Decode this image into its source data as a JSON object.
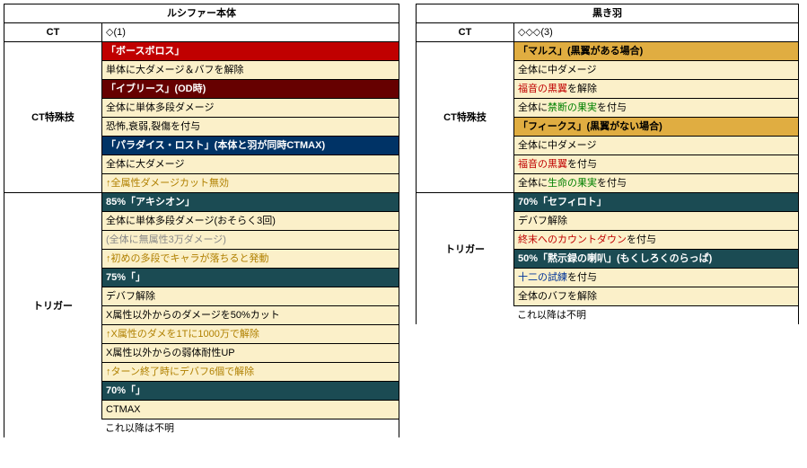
{
  "left": {
    "title": "ルシファー本体",
    "ct_label": "CT",
    "ct_value": "◇(1)",
    "sections": {
      "ct_skill": {
        "label": "CT特殊技",
        "rows": [
          {
            "cls": "hdr hdr-dred",
            "text": "「ボースボロス」"
          },
          {
            "cls": "line-cream",
            "text": "単体に大ダメージ＆バフを解除"
          },
          {
            "cls": "hdr hdr-crim",
            "text": "「イブリース」(OD時)"
          },
          {
            "cls": "line-cream",
            "text": "全体に単体多段ダメージ"
          },
          {
            "cls": "line-cream",
            "text": "恐怖,衰弱,裂傷を付与"
          },
          {
            "cls": "hdr hdr-blue",
            "text": "「パラダイス・ロスト」(本体と羽が同時CTMAX)"
          },
          {
            "cls": "line-cream",
            "text": "全体に大ダメージ"
          },
          {
            "cls": "line-cream sub-gold",
            "text": "↑全属性ダメージカット無効"
          }
        ]
      },
      "trigger": {
        "label": "トリガー",
        "rows": [
          {
            "cls": "hdr hdr-teal",
            "text": "85%「アキシオン」"
          },
          {
            "cls": "line-cream",
            "text": "全体に単体多段ダメージ(おそらく3回)"
          },
          {
            "cls": "line-cream grey",
            "text": "(全体に無属性3万ダメージ)"
          },
          {
            "cls": "line-cream sub-gold",
            "text": "↑初めの多段でキャラが落ちると発動"
          },
          {
            "cls": "hdr hdr-teal",
            "text": "75%「」"
          },
          {
            "cls": "line-cream",
            "text": "デバフ解除"
          },
          {
            "cls": "line-cream",
            "text": "X属性以外からのダメージを50%カット"
          },
          {
            "cls": "line-cream sub-gold",
            "text": "↑X属性のダメを1Tに1000万で解除"
          },
          {
            "cls": "line-cream",
            "text": "X属性以外からの弱体耐性UP"
          },
          {
            "cls": "line-cream sub-gold",
            "text": "↑ターン終了時にデバフ6個で解除"
          },
          {
            "cls": "hdr hdr-teal",
            "text": "70%「」"
          },
          {
            "cls": "line-cream",
            "text": "CTMAX"
          }
        ]
      }
    },
    "footer": "これ以降は不明"
  },
  "right": {
    "title": "黒き羽",
    "ct_label": "CT",
    "ct_value": "◇◇◇(3)",
    "sections": {
      "ct_skill": {
        "label": "CT特殊技",
        "rows": [
          {
            "cls": "hdr hdr-gold",
            "text": "「マルス」(黒翼がある場合)"
          },
          {
            "cls": "line-cream",
            "text": "全体に中ダメージ"
          },
          {
            "cls": "line-cream",
            "html": "<span class='red'>福音の黒翼</span>を解除"
          },
          {
            "cls": "line-cream",
            "html": "全体に<span class='green'>禁断の果実</span>を付与"
          },
          {
            "cls": "hdr hdr-gold",
            "text": "「フィークス」(黒翼がない場合)"
          },
          {
            "cls": "line-cream",
            "text": "全体に中ダメージ"
          },
          {
            "cls": "line-cream",
            "html": "<span class='red'>福音の黒翼</span>を付与"
          },
          {
            "cls": "line-cream",
            "html": "全体に<span class='green'>生命の果実</span>を付与"
          }
        ]
      },
      "trigger": {
        "label": "トリガー",
        "rows": [
          {
            "cls": "hdr hdr-teal",
            "text": "70%「セフィロト」"
          },
          {
            "cls": "line-cream",
            "text": "デバフ解除"
          },
          {
            "cls": "line-cream",
            "html": "<span class='red'>終末へのカウントダウン</span>を付与"
          },
          {
            "cls": "hdr hdr-teal",
            "text": "50%「黙示録の喇叭」(もくしろくのらっぱ)"
          },
          {
            "cls": "line-cream",
            "html": "<span class='blue2'>十二の試練</span>を付与"
          },
          {
            "cls": "line-cream",
            "text": "全体のバフを解除"
          }
        ]
      }
    },
    "footer": "これ以降は不明"
  }
}
